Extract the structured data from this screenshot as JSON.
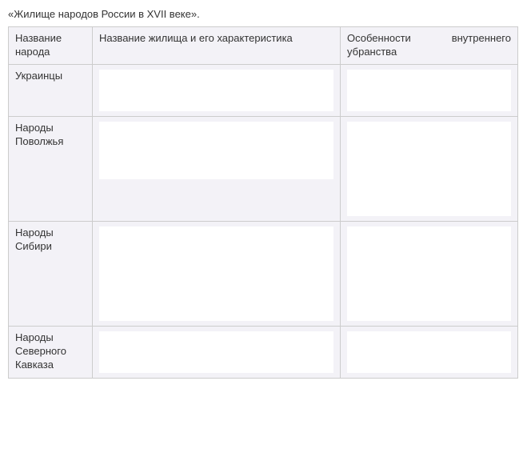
{
  "title": "«Жилище народов России в XVII веке».",
  "headers": {
    "col1": "Название народа",
    "col2": "Название жилища и его характеристика",
    "col3_a": "Особенности",
    "col3_b": "внутреннего",
    "col3_c": "убранства"
  },
  "rows": [
    {
      "name": "Украинцы"
    },
    {
      "name": "Народы Поволжья"
    },
    {
      "name": "Народы Сибири"
    },
    {
      "name": "Народы Северного Кавказа"
    }
  ]
}
